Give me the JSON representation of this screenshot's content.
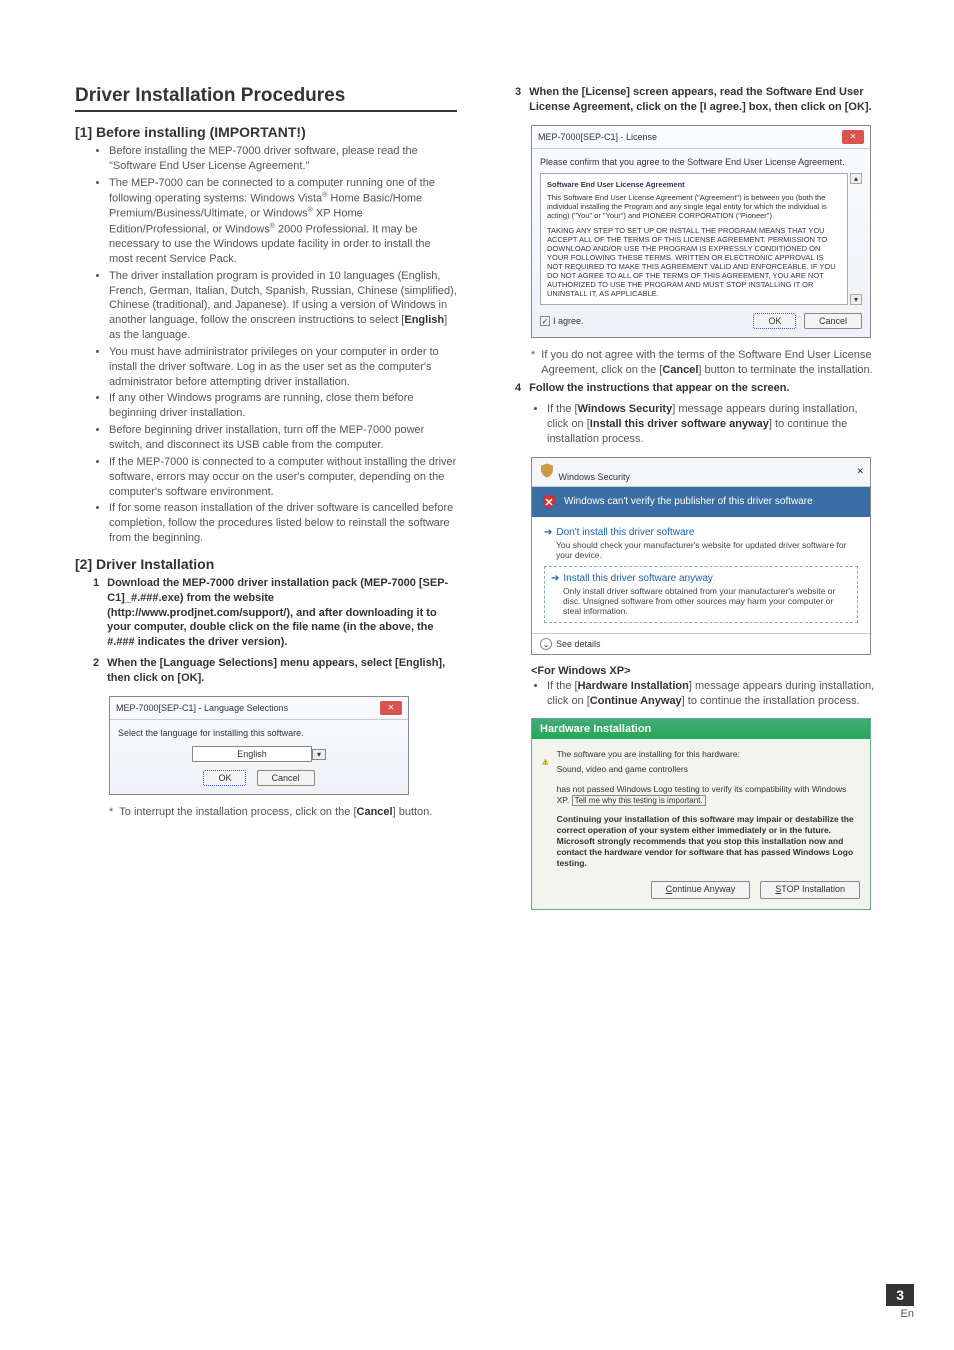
{
  "left": {
    "mainHeading": "Driver Installation Procedures",
    "sec1": {
      "title": "[1] Before installing (IMPORTANT!)",
      "b1": "Before installing the MEP-7000 driver software, please read the \"Software End User License Agreement.\"",
      "b2a": "The MEP-7000 can be connected to a computer running one of the following operating systems: Windows Vista",
      "b2b": " Home Basic/Home Premium/Business/Ultimate, or Windows",
      "b2c": " XP Home Edition/Professional, or Windows",
      "b2d": " 2000 Professional. It may be necessary to use the Windows update facility in order to install the most recent Service Pack.",
      "b3a": "The driver installation program is provided in 10 languages (English, French, German, Italian, Dutch, Spanish, Russian, Chinese (simplified), Chinese (traditional), and Japanese). If using a version of Windows in another language, follow the onscreen instructions to select [",
      "b3b": "English",
      "b3c": "] as the language.",
      "b4": "You must have administrator privileges on your computer in order to install the driver software. Log in as the user set as the computer's administrator before attempting driver installation.",
      "b5": "If any other Windows programs are running, close them before beginning driver installation.",
      "b6": "Before beginning driver installation, turn off the MEP-7000 power switch, and disconnect its USB cable from the computer.",
      "b7": "If the MEP-7000 is connected to a computer without installing the driver software, errors may occur on the user's computer, depending on the computer's software environment.",
      "b8": "If for some reason installation of the driver software is cancelled before completion, follow the procedures listed below to reinstall the software from the beginning."
    },
    "sec2": {
      "title": "[2] Driver Installation",
      "step1": "Download the MEP-7000 driver installation pack (MEP-7000 [SEP-C1]_#.###.exe) from the website (http://www.prodjnet.com/support/), and after downloading it to your computer, double click on the file name (in the above, the #.### indicates the driver version).",
      "step2": "When the [Language Selections] menu appears, select [English], then click on [OK]."
    },
    "langDialog": {
      "title": "MEP-7000[SEP-C1] - Language Selections",
      "prompt": "Select the language for installing this software.",
      "value": "English",
      "ok": "OK",
      "cancel": "Cancel"
    },
    "langNoteA": "To interrupt the installation process, click on the [",
    "langNoteB": "Cancel",
    "langNoteC": "] button."
  },
  "right": {
    "step3": "When the [License] screen appears, read the Software End User License Agreement, click on the [I agree.] box, then click on [OK].",
    "lic": {
      "title": "MEP-7000[SEP-C1] - License",
      "prompt": "Please confirm that you agree to the Software End User License Agreement.",
      "heading": "Software End User License Agreement",
      "p1": "This Software End User License Agreement (\"Agreement\") is between you (both the individual installing the Program and any single legal entity for which the individual is acting) (\"You\" or \"Your\") and PIONEER CORPORATION (\"Pioneer\").",
      "p2": "TAKING ANY STEP TO SET UP OR INSTALL THE PROGRAM MEANS THAT YOU ACCEPT ALL OF THE TERMS OF THIS LICENSE AGREEMENT. PERMISSION TO DOWNLOAD AND/OR USE THE PROGRAM IS EXPRESSLY CONDITIONED ON YOUR FOLLOWING THESE TERMS. WRITTEN OR ELECTRONIC APPROVAL IS NOT REQUIRED TO MAKE THIS AGREEMENT VALID AND ENFORCEABLE. IF YOU DO NOT AGREE TO ALL OF THE TERMS OF THIS AGREEMENT, YOU ARE NOT AUTHORIZED TO USE THE PROGRAM AND MUST STOP INSTALLING IT OR UNINSTALL IT, AS APPLICABLE.",
      "agree": "I agree.",
      "ok": "OK",
      "cancel": "Cancel"
    },
    "licNoteA": "If you do not agree with the terms of the Software End User License Agreement, click on the [",
    "licNoteB": "Cancel",
    "licNoteC": "] button to terminate the installation.",
    "step4": "Follow the instructions that appear on the screen.",
    "step4subA": "If the [",
    "step4subB": "Windows Security",
    "step4subC": "] message appears during installation, click on [",
    "step4subD": "Install this driver software anyway",
    "step4subE": "] to continue the installation process.",
    "sec": {
      "title": "Windows Security",
      "banner": "Windows can't verify the publisher of this driver software",
      "opt1": "Don't install this driver software",
      "opt1sub": "You should check your manufacturer's website for updated driver software for your device.",
      "opt2": "Install this driver software anyway",
      "opt2sub": "Only install driver software obtained from your manufacturer's website or disc. Unsigned software from other sources may harm your computer or steal information.",
      "details": "See details"
    },
    "xpHead": "<For Windows XP>",
    "xpNoteA": "If the [",
    "xpNoteB": "Hardware Installation",
    "xpNoteC": "] message appears during installation, click on [",
    "xpNoteD": "Continue Anyway",
    "xpNoteE": "] to continue the installation process.",
    "xp": {
      "title": "Hardware Installation",
      "line1": "The software you are installing for this hardware:",
      "line2": "Sound, video and game controllers",
      "line3a": "has not passed Windows Logo testing to verify its compatibility with Windows XP. ",
      "link": "Tell me why this testing is important.",
      "bold": "Continuing your installation of this software may impair or destabilize the correct operation of your system either immediately or in the future. Microsoft strongly recommends that you stop this installation now and contact the hardware vendor for software that has passed Windows Logo testing.",
      "cont": "Continue Anyway",
      "stop": "STOP Installation"
    }
  },
  "footer": {
    "page": "3",
    "lang": "En"
  }
}
